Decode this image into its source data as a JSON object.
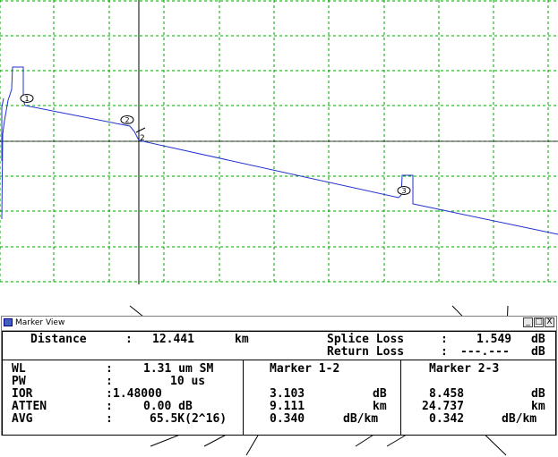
{
  "marker_view": {
    "title": "Marker View",
    "window_buttons": {
      "minimize": "_",
      "maximize": "□",
      "close": "X"
    },
    "distance": {
      "label": "Distance",
      "sep": ":",
      "value": "12.441",
      "unit": "km"
    },
    "splice_loss": {
      "label": "Splice Loss",
      "sep": ":",
      "value": "1.549",
      "unit": "dB"
    },
    "return_loss": {
      "label": "Return Loss",
      "sep": ":",
      "value": "---.---",
      "unit": "dB"
    },
    "params": [
      {
        "label": "WL",
        "sep": ":",
        "value": "1.31 um SM"
      },
      {
        "label": "PW",
        "sep": ":",
        "value": "10 us"
      },
      {
        "label": "IOR",
        "sep": ":",
        "value": "1.48000"
      },
      {
        "label": "ATTEN",
        "sep": ":",
        "value": "0.00 dB"
      },
      {
        "label": "AVG",
        "sep": ":",
        "value": "65.5K(2^16)"
      }
    ],
    "marker_12": {
      "header": "Marker 1-2",
      "loss": "3.103",
      "loss_unit": "dB",
      "dist": "9.111",
      "dist_unit": "km",
      "slope": "0.340",
      "slope_unit": "dB/km"
    },
    "marker_23": {
      "header": "Marker 2-3",
      "loss": "8.458",
      "loss_unit": "dB",
      "dist": "24.737",
      "dist_unit": "km",
      "slope": "0.342",
      "slope_unit": "dB/km"
    }
  },
  "trace": {
    "markers": [
      "1",
      "2",
      "3"
    ],
    "cursor_label": "2",
    "grid_color": "#00a000",
    "trace_color": "#2030d0"
  }
}
